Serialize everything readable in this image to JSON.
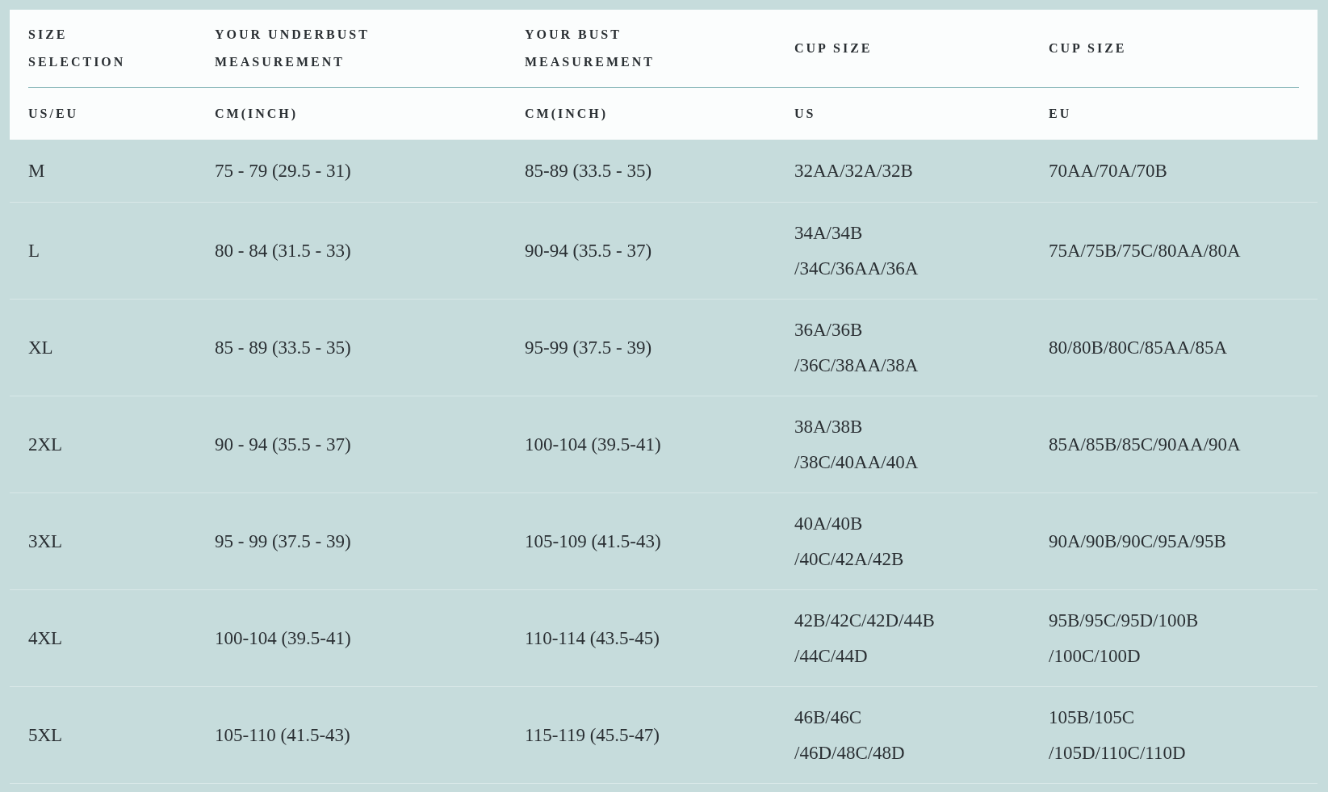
{
  "table": {
    "columns": [
      {
        "title": "SIZE\nSELECTION",
        "unit": "US/EU"
      },
      {
        "title": "YOUR UNDERBUST\nMEASUREMENT",
        "unit": "CM(INCH)"
      },
      {
        "title": "YOUR BUST\nMEASUREMENT",
        "unit": "CM(INCH)"
      },
      {
        "title": "CUP SIZE",
        "unit": "US"
      },
      {
        "title": "CUP SIZE",
        "unit": "EU"
      }
    ],
    "rows": [
      [
        "M",
        "75 - 79 (29.5 - 31)",
        "85-89 (33.5 - 35)",
        "32AA/32A/32B",
        "70AA/70A/70B"
      ],
      [
        "L",
        "80 - 84 (31.5 - 33)",
        "90-94 (35.5 - 37)",
        "34A/34B\n/34C/36AA/36A",
        "75A/75B/75C/80AA/80A"
      ],
      [
        "XL",
        "85 - 89 (33.5 - 35)",
        "95-99 (37.5 - 39)",
        "36A/36B\n/36C/38AA/38A",
        "80/80B/80C/85AA/85A"
      ],
      [
        "2XL",
        "90 - 94 (35.5 - 37)",
        "100-104 (39.5-41)",
        "38A/38B\n/38C/40AA/40A",
        "85A/85B/85C/90AA/90A"
      ],
      [
        "3XL",
        "95 - 99 (37.5 - 39)",
        "105-109 (41.5-43)",
        "40A/40B\n/40C/42A/42B",
        "90A/90B/90C/95A/95B"
      ],
      [
        "4XL",
        "100-104 (39.5-41)",
        "110-114 (43.5-45)",
        "42B/42C/42D/44B\n/44C/44D",
        "95B/95C/95D/100B\n/100C/100D"
      ],
      [
        "5XL",
        "105-110 (41.5-43)",
        "115-119 (45.5-47)",
        "46B/46C\n/46D/48C/48D",
        "105B/105C\n/105D/110C/110D"
      ]
    ]
  }
}
